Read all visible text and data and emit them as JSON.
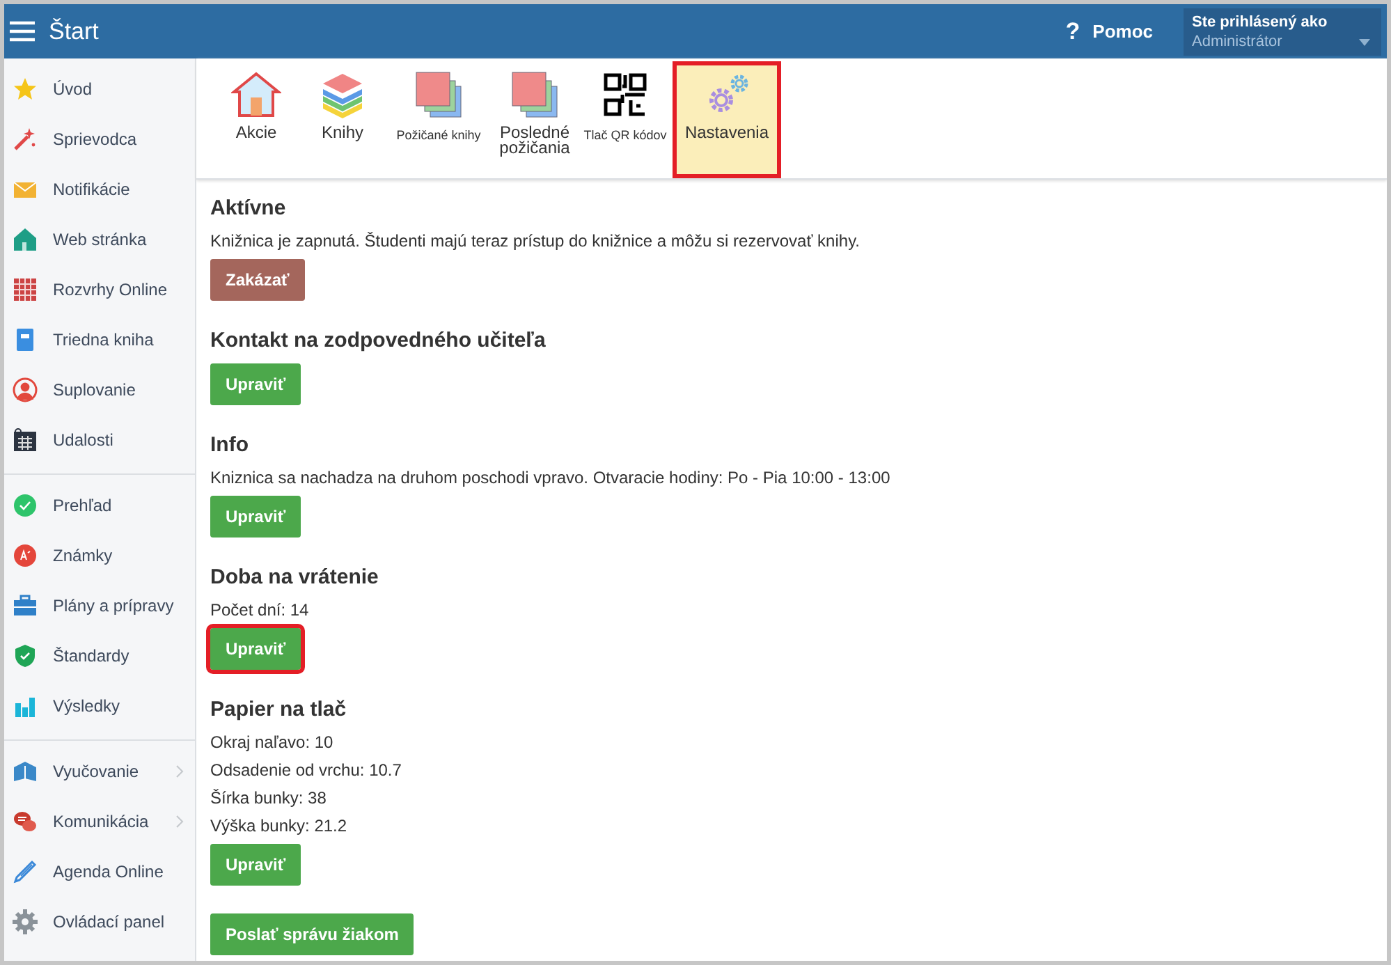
{
  "top_bar": {
    "title": "Štart",
    "help": {
      "icon_text": "?",
      "label": "Pomoc"
    },
    "user": {
      "caption": "Ste prihlásený ako",
      "name": "Administrátor"
    }
  },
  "sidebar": {
    "groups": [
      {
        "items": [
          {
            "label": "Úvod",
            "has_submenu": false
          },
          {
            "label": "Sprievodca",
            "has_submenu": false
          },
          {
            "label": "Notifikácie",
            "has_submenu": false
          },
          {
            "label": "Web stránka",
            "has_submenu": false
          },
          {
            "label": "Rozvrhy Online",
            "has_submenu": false
          },
          {
            "label": "Triedna kniha",
            "has_submenu": false
          },
          {
            "label": "Suplovanie",
            "has_submenu": false
          },
          {
            "label": "Udalosti",
            "has_submenu": false
          }
        ]
      },
      {
        "items": [
          {
            "label": "Prehľad",
            "has_submenu": false
          },
          {
            "label": "Známky",
            "has_submenu": false
          },
          {
            "label": "Plány a prípravy",
            "has_submenu": false
          },
          {
            "label": "Štandardy",
            "has_submenu": false
          },
          {
            "label": "Výsledky",
            "has_submenu": false
          }
        ]
      },
      {
        "items": [
          {
            "label": "Vyučovanie",
            "has_submenu": true
          },
          {
            "label": "Komunikácia",
            "has_submenu": true
          },
          {
            "label": "Agenda Online",
            "has_submenu": false
          },
          {
            "label": "Ovládací panel",
            "has_submenu": false
          }
        ]
      }
    ]
  },
  "toolbar": [
    {
      "label": "Akcie",
      "small": false,
      "selected": false,
      "highlighted": false
    },
    {
      "label": "Knihy",
      "small": false,
      "selected": false,
      "highlighted": false
    },
    {
      "label": "Požičané knihy",
      "small": true,
      "selected": false,
      "highlighted": false
    },
    {
      "label": "Posledné požičania",
      "small": false,
      "selected": false,
      "highlighted": false
    },
    {
      "label": "Tlač QR kódov",
      "small": true,
      "selected": false,
      "highlighted": false
    },
    {
      "label": "Nastavenia",
      "small": false,
      "selected": true,
      "highlighted": true
    }
  ],
  "sections": [
    {
      "title": "Aktívne",
      "lines": [
        "Knižnica je zapnutá. Študenti majú teraz prístup do knižnice a môžu si rezervovať knihy."
      ],
      "button": {
        "label": "Zakázať",
        "kind": "danger",
        "highlighted": false
      }
    },
    {
      "title": "Kontakt na zodpovedného učiteľa",
      "button": {
        "label": "Upraviť",
        "kind": "primary",
        "highlighted": false
      }
    },
    {
      "title": "Info",
      "lines": [
        "Kniznica sa nachadza na druhom poschodi vpravo. Otvaracie hodiny: Po - Pia 10:00 - 13:00"
      ],
      "button": {
        "label": "Upraviť",
        "kind": "primary",
        "highlighted": false
      }
    },
    {
      "title": "Doba na vrátenie",
      "lines": [
        "Počet dní: 14"
      ],
      "button": {
        "label": "Upraviť",
        "kind": "primary",
        "highlighted": true
      }
    },
    {
      "title": "Papier na tlač",
      "lines": [
        "Okraj naľavo: 10",
        "Odsadenie od vrchu: 10.7",
        "Šírka bunky: 38",
        "Výška bunky: 21.2"
      ],
      "button": {
        "label": "Upraviť",
        "kind": "primary",
        "highlighted": false
      }
    }
  ],
  "footer_button": {
    "label": "Poslať správu žiakom",
    "kind": "primary",
    "highlighted": false
  }
}
